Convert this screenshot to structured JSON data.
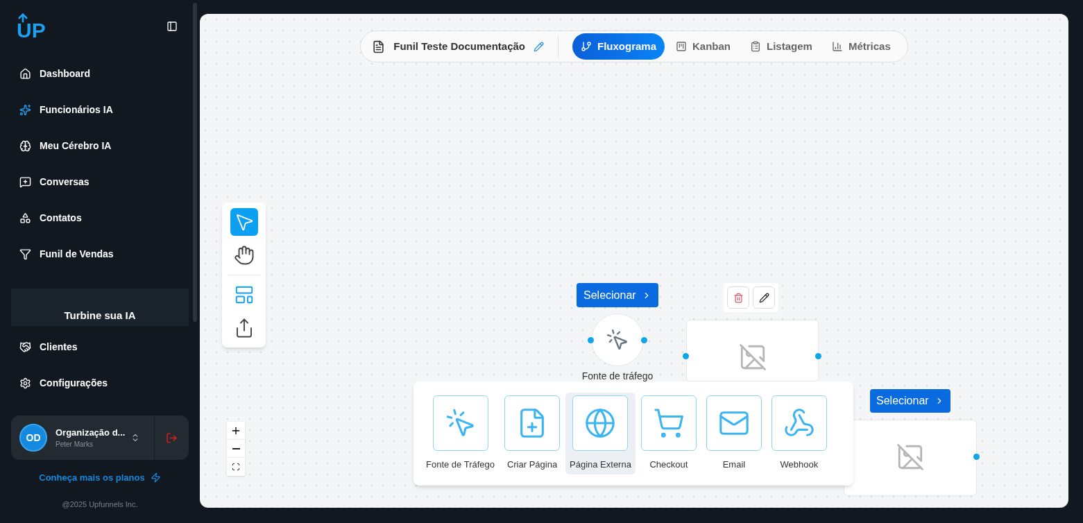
{
  "sidebar": {
    "logo": "UP",
    "nav": [
      {
        "label": "Dashboard",
        "kind": "home"
      },
      {
        "label": "Funcionários IA",
        "kind": "sparkles"
      },
      {
        "label": "Meu Cérebro IA",
        "kind": "brain"
      },
      {
        "label": "Conversas",
        "kind": "chat"
      },
      {
        "label": "Contatos",
        "kind": "shapes"
      },
      {
        "label": "Funil de Vendas",
        "kind": "funnel"
      }
    ],
    "promo": "Turbine sua IA",
    "nav_bottom": [
      {
        "label": "Clientes",
        "kind": "handshake"
      },
      {
        "label": "Configurações",
        "kind": "gear"
      }
    ],
    "account": {
      "initials": "OD",
      "organization": "Organização d...",
      "user": "Peter Marks"
    },
    "plans_link": "Conheça mais os planos",
    "copyright": "@2025 Upfunnels Inc."
  },
  "topbar": {
    "title": "Funil Teste Documentação",
    "tabs": [
      {
        "label": "Fluxograma",
        "kind": "flow",
        "selected": true
      },
      {
        "label": "Kanban",
        "kind": "kanban",
        "selected": false
      },
      {
        "label": "Listagem",
        "kind": "list",
        "selected": false
      },
      {
        "label": "Métricas",
        "kind": "chart",
        "selected": false
      }
    ]
  },
  "tools": [
    {
      "kind": "pointer",
      "selected": true
    },
    {
      "kind": "hand",
      "selected": false
    },
    {
      "kind": "layout",
      "selected": false
    },
    {
      "kind": "share",
      "selected": false
    }
  ],
  "nodes": {
    "source": {
      "select": "Selecionar",
      "label": "Fonte de tráfego"
    },
    "page_select": "Selecionar"
  },
  "palette": [
    {
      "label": "Fonte de Tráfego",
      "kind": "click",
      "selected": false
    },
    {
      "label": "Criar Página",
      "kind": "file",
      "selected": false
    },
    {
      "label": "Página Externa",
      "kind": "globe",
      "selected": true
    },
    {
      "label": "Checkout",
      "kind": "cart",
      "selected": false
    },
    {
      "label": "Email",
      "kind": "mail",
      "selected": false
    },
    {
      "label": "Webhook",
      "kind": "webhook",
      "selected": false
    }
  ]
}
